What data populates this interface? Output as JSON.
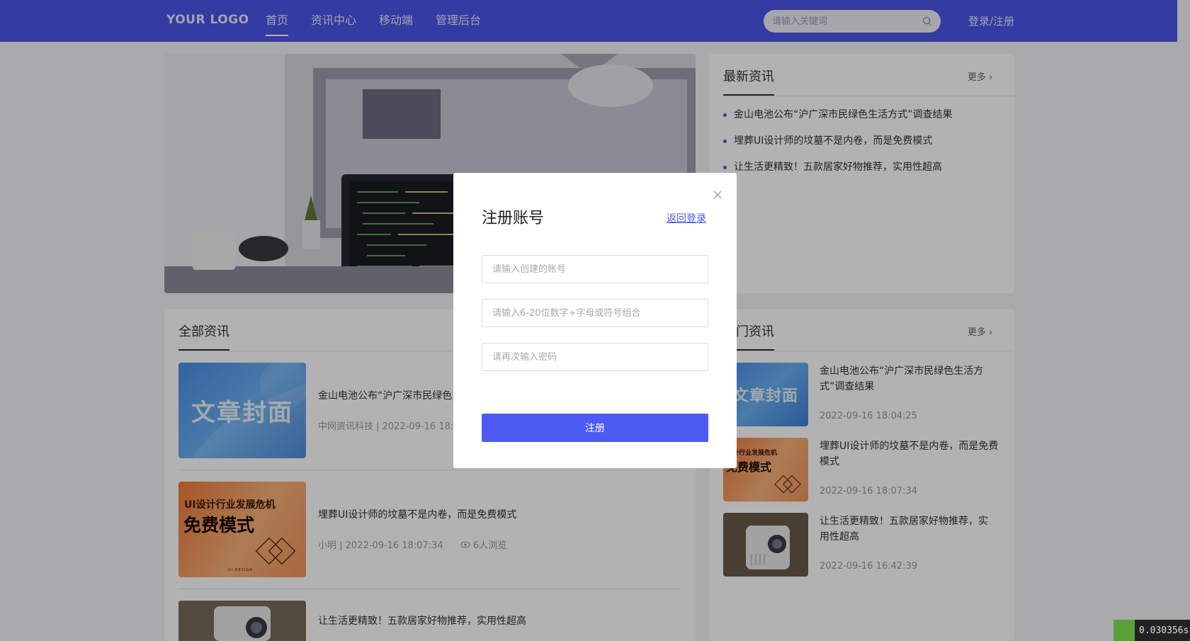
{
  "header": {
    "logo": "YOUR LOGO",
    "nav": [
      "首页",
      "资讯中心",
      "移动端",
      "管理后台"
    ],
    "search_placeholder": "请输入关键词",
    "login_label": "登录/注册"
  },
  "latest_news": {
    "title": "最新资讯",
    "more_label": "更多",
    "items": [
      "金山电池公布“沪广深市民绿色生活方式”调查结果",
      "埋葬UI设计师的坟墓不是内卷，而是免费模式",
      "让生活更精致！五款居家好物推荐，实用性超高"
    ]
  },
  "all_news": {
    "title": "全部资讯",
    "articles": [
      {
        "thumb_text": "文章封面",
        "title": "金山电池公布“沪广深市民绿色",
        "meta": "中网资讯科技 | 2022-09-16 18:"
      },
      {
        "thumb_line1": "UI设计行业发展危机",
        "thumb_line2": "免费模式",
        "thumb_caption": "UI DESIGN",
        "title": "埋葬UI设计师的坟墓不是内卷，而是免费模式",
        "meta": "小明 | 2022-09-16 18:07:34",
        "views": "6人浏览"
      },
      {
        "title": "让生活更精致！五款居家好物推荐，实用性超高"
      }
    ]
  },
  "hot_news": {
    "title": "门资讯",
    "more_label": "更多",
    "articles": [
      {
        "thumb_text": "文章封面",
        "title": "金山电池公布“沪广深市民绿色生活方式”调查结果",
        "time": "2022-09-16 18:04:25"
      },
      {
        "thumb_line1": "设计行业发展危机",
        "thumb_line2": "免费模式",
        "title": "埋葬UI设计师的坟墓不是内卷，而是免费模式",
        "time": "2022-09-16 18:07:34"
      },
      {
        "title": "让生活更精致！五款居家好物推荐，实用性超高",
        "time": "2022-09-16 16:42:39"
      }
    ]
  },
  "modal": {
    "title": "注册账号",
    "back_login": "返回登录",
    "account_placeholder": "请输入创建的账号",
    "password_placeholder": "请输入6-20位数字+字母或符号组合",
    "confirm_placeholder": "请再次输入密码",
    "submit_label": "注册"
  },
  "timer": "0.030356s",
  "colors": {
    "primary": "#4b55e8",
    "button": "#4e5bf2"
  }
}
